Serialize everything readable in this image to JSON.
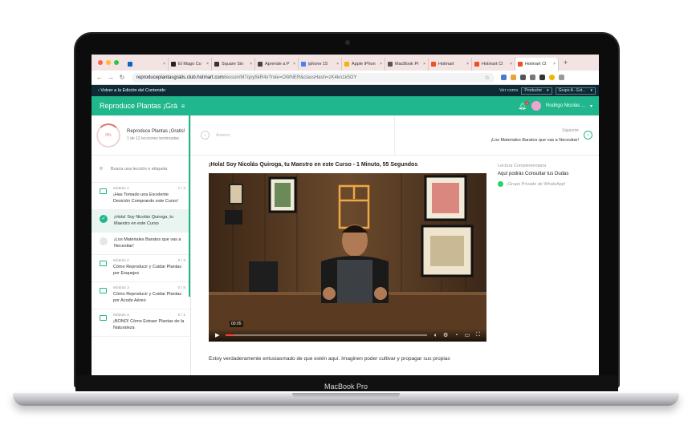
{
  "device": {
    "model_label": "MacBook Pro"
  },
  "browser": {
    "tabs": [
      {
        "label": "",
        "icon": "linkedin-icon",
        "color": "#0a66c2"
      },
      {
        "label": "El Mago Co",
        "icon": "site-icon",
        "color": "#222222"
      },
      {
        "label": "Square Sio",
        "icon": "square-icon",
        "color": "#333333"
      },
      {
        "label": "Aprende a P",
        "icon": "site-icon",
        "color": "#444444"
      },
      {
        "label": "iphone 15",
        "icon": "google-icon",
        "color": "#4285f4"
      },
      {
        "label": "Apple iPhon",
        "icon": "apple-icon",
        "color": "#f4b400"
      },
      {
        "label": "MacBook Pr",
        "icon": "apple-icon",
        "color": "#555555"
      },
      {
        "label": "Hotmart",
        "icon": "hotmart-icon",
        "color": "#f04e23"
      },
      {
        "label": "Hotmart Cl",
        "icon": "hotmart-icon",
        "color": "#f04e23"
      },
      {
        "label": "Hotmart Cl",
        "icon": "hotmart-icon",
        "color": "#f04e23"
      }
    ],
    "url_host": "reproduceplantasgratis.club.hotmart.com",
    "url_path": "/lesson/M7qoy5kR4x?role=OWNER&classHash=zK4kn1k5OY"
  },
  "appbar": {
    "back_label": "‹ Volver a la Edición del Contenido",
    "view_as_label": "Ver como",
    "view_as_value": "Productor",
    "group_value": "Grupo A - Est..."
  },
  "header": {
    "course_title": "Reproduce Plantas ¡Grá",
    "notification_count": "1",
    "user_name": "Rodrigo Nicolas ..."
  },
  "sidebar": {
    "progress_percent": "0%",
    "course_name": "Reproduce Plantas ¡Gratis!",
    "progress_text": "1 de 12 lecciones terminadas",
    "search_placeholder": "Busca una lección o etiqueta",
    "modules": [
      {
        "module": "Módulo 1",
        "count": "1 / 2",
        "title": "¡Has Tomado una Excelente Desición Comprando este Curso!"
      },
      {
        "module": "Módulo 2",
        "count": "0 / 3",
        "title": "Cómo Reproducir y Cuidar Plantas por Esquejes"
      },
      {
        "module": "Módulo 3",
        "count": "0 / 5",
        "title": "Cómo Reproducir y Cuidar Plantas por Acodo Aéreo"
      },
      {
        "module": "Módulo 4",
        "count": "0 / 1",
        "title": "¡BONO! Cómo Extraer Plantas de la Naturaleza"
      }
    ],
    "lessons": [
      {
        "title": "¡Hola! Soy Nicolás Quiroga, tu Maestro en este Curso",
        "done": true
      },
      {
        "title": "¡Los Materiales Baratos que vas a Necesitar!",
        "done": false
      }
    ]
  },
  "lesson_nav": {
    "prev_label": "Anterior",
    "next_label": "Siguiente",
    "next_title": "¡Los Materiales Baratos que vas a Necesitar!"
  },
  "lesson": {
    "title": "¡Hola! Soy Nicolás Quiroga, tu Maestro en este Curso - 1 Minuto, 55 Segundos",
    "video_time": "00:05",
    "video_progress": 0.04,
    "description": "Estoy verdaderamente entusiasmado de que estén aquí. Imaginen poder cultivar y propagar sus propias"
  },
  "aside": {
    "heading": "Lectura Complementaria",
    "link_label": "Aquí podrás Consultar tus Dudas",
    "whatsapp_label": "¡Grupo Privado de WhatsApp!"
  },
  "colors": {
    "accent": "#20b78d",
    "appbar": "#0d2a35",
    "tabbar": "#f3e3e3"
  }
}
